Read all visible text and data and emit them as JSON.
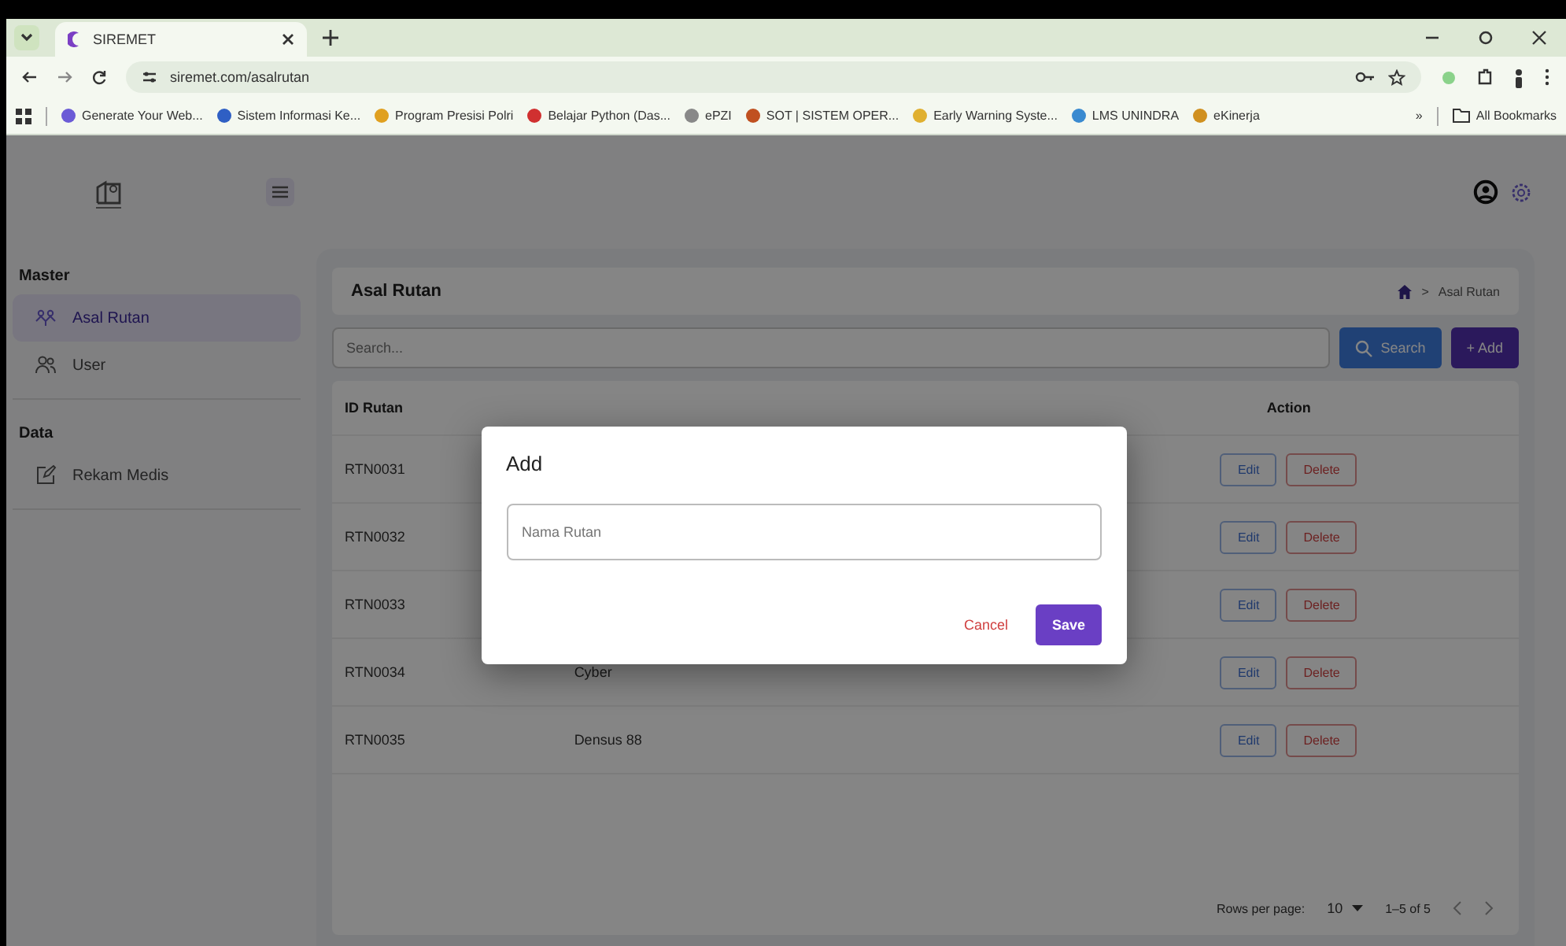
{
  "browser": {
    "tab_title": "SIREMET",
    "url": "siremet.com/asalrutan",
    "bookmarks": [
      "Generate Your Web...",
      "Sistem Informasi Ke...",
      "Program Presisi Polri",
      "Belajar Python (Das...",
      "ePZI",
      "SOT | SISTEM OPER...",
      "Early Warning Syste...",
      "LMS UNINDRA",
      "eKinerja"
    ],
    "more": "»",
    "all_bookmarks": "All Bookmarks"
  },
  "sidebar": {
    "sections": [
      {
        "title": "Master",
        "items": [
          {
            "label": "Asal Rutan",
            "kind": "group",
            "selected": true
          },
          {
            "label": "User",
            "kind": "user",
            "selected": false
          }
        ]
      },
      {
        "title": "Data",
        "items": [
          {
            "label": "Rekam Medis",
            "kind": "edit",
            "selected": false
          }
        ]
      }
    ]
  },
  "page": {
    "title": "Asal Rutan",
    "breadcrumb": [
      ">",
      "Asal Rutan"
    ],
    "search": {
      "placeholder": "Search..."
    },
    "search_button": "Search",
    "add_button": "+ Add"
  },
  "table": {
    "columns": [
      "ID Rutan",
      "",
      "Action"
    ],
    "rows": [
      {
        "id": "RTN0031",
        "name": "",
        "actions": [
          "Edit",
          "Delete"
        ]
      },
      {
        "id": "RTN0032",
        "name": "",
        "actions": [
          "Edit",
          "Delete"
        ]
      },
      {
        "id": "RTN0033",
        "name": "",
        "actions": [
          "Edit",
          "Delete"
        ]
      },
      {
        "id": "RTN0034",
        "name": "Cyber",
        "actions": [
          "Edit",
          "Delete"
        ]
      },
      {
        "id": "RTN0035",
        "name": "Densus 88",
        "actions": [
          "Edit",
          "Delete"
        ]
      }
    ]
  },
  "pagination": {
    "label": "Rows per page:",
    "rows_per_page": "10",
    "range": "1–5 of 5"
  },
  "modal": {
    "title": "Add",
    "field": {
      "placeholder": "Nama Rutan"
    },
    "cancel": "Cancel",
    "save": "Save"
  }
}
